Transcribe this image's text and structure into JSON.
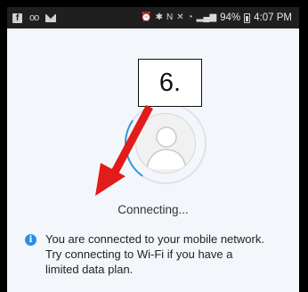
{
  "status_bar": {
    "left_icons": [
      "facebook-icon",
      "voicemail-icon",
      "email-icon"
    ],
    "right_icons": [
      "alarm-icon",
      "bluetooth-icon",
      "nfc-icon",
      "mute-icon",
      "wifi-icon",
      "lte-signal-icon"
    ],
    "battery_percent": "94%",
    "time": "4:07 PM"
  },
  "avatar": {
    "icon": "person-silhouette-icon"
  },
  "status": {
    "connecting_text": "Connecting..."
  },
  "notice": {
    "icon": "info-icon",
    "line1": "You are connected to your mobile network.",
    "line2": "Try connecting to Wi-Fi if you have a",
    "line3": "limited data plan."
  },
  "annotation": {
    "step_label": "6.",
    "arrow_color": "#e21b1b"
  },
  "colors": {
    "accent_blue": "#2b8ee6",
    "screen_background": "#f3f7fb",
    "status_bar_background": "#1f1f1f"
  }
}
